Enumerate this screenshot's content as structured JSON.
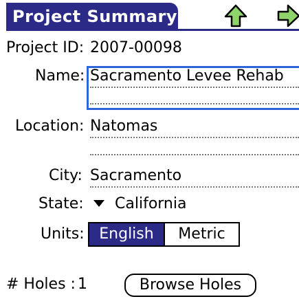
{
  "header": {
    "title": "Project Summary",
    "nav_up_icon": "up-arrow-icon",
    "nav_right_icon": "right-arrow-icon",
    "accent_color": "#2b2a87",
    "arrow_color": "#8fd46a"
  },
  "form": {
    "project_id_label": "Project ID:",
    "project_id_value": "2007-00098",
    "name_label": "Name:",
    "name_value": "Sacramento Levee Rehab",
    "location_label": "Location:",
    "location_value": "Natomas",
    "city_label": "City:",
    "city_value": "Sacramento",
    "state_label": "State:",
    "state_value": "California",
    "units_label": "Units:",
    "units_options": [
      "English",
      "Metric"
    ],
    "units_selected": "English"
  },
  "footer": {
    "holes_label": "# Holes :",
    "holes_count": "1",
    "browse_label": "Browse Holes"
  }
}
